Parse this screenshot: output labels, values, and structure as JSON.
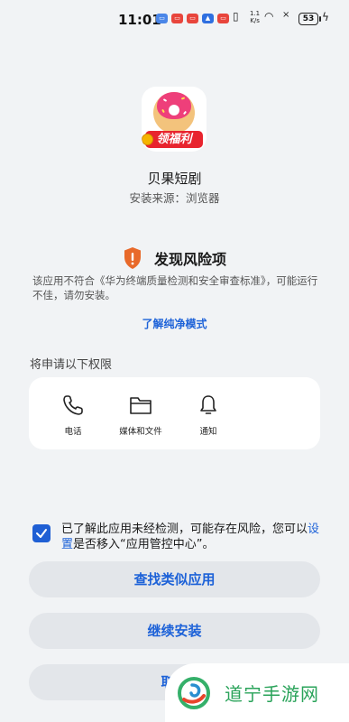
{
  "status_bar": {
    "time": "11:01",
    "net_speed_top": "1.1",
    "net_speed_bottom": "K/s",
    "battery": "53"
  },
  "app": {
    "name": "贝果短剧",
    "source": "安装来源：浏览器",
    "icon_badge_text": "领福利"
  },
  "risk": {
    "title": "发现风险项",
    "description": "该应用不符合《华为终端质量检测和安全审查标准》，可能运行不佳，请勿安装。",
    "learn_more": "了解纯净模式"
  },
  "permissions": {
    "title": "将申请以下权限",
    "items": [
      {
        "label": "电话",
        "icon": "phone-icon"
      },
      {
        "label": "媒体和文件",
        "icon": "folder-icon"
      },
      {
        "label": "通知",
        "icon": "bell-icon"
      }
    ]
  },
  "consent": {
    "checked": true,
    "text_before": "已了解此应用未经检测，可能存在风险，您可以",
    "link": "设置",
    "text_after": "是否移入“应用管控中心”。"
  },
  "buttons": {
    "find_similar": "查找类似应用",
    "continue_install": "继续安装",
    "cancel": "取消"
  },
  "watermark": {
    "text": "道宁手游网"
  },
  "colors": {
    "accent": "#1d62d8",
    "warning": "#e8692a",
    "background": "#f1f3f5",
    "watermark_green": "#2aa35a"
  }
}
